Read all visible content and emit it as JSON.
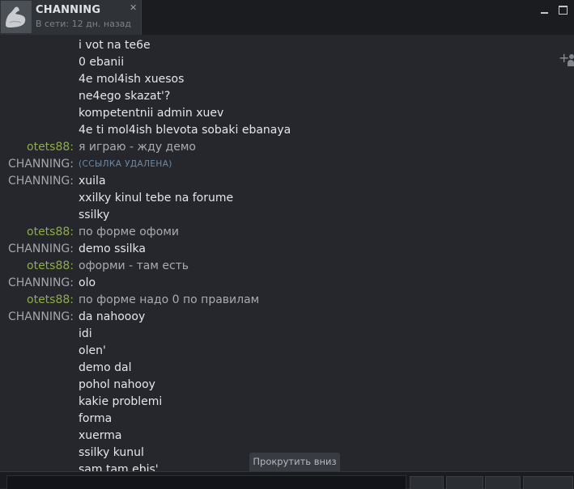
{
  "tab": {
    "name": "CHANNING",
    "status": "В сети: 12 дн. назад",
    "close": "✕"
  },
  "chat": {
    "messages": [
      {
        "sender": "",
        "text": "i vot na te6e",
        "kind": "me"
      },
      {
        "sender": "",
        "text": "0 ebanii",
        "kind": "me"
      },
      {
        "sender": "",
        "text": "4e mol4ish xuesos",
        "kind": "me"
      },
      {
        "sender": "",
        "text": "ne4ego skazat'?",
        "kind": "me"
      },
      {
        "sender": "",
        "text": "kompetentnii admin xuev",
        "kind": "me"
      },
      {
        "sender": "",
        "text": "4e ti mol4ish blevota sobaki ebanaya",
        "kind": "me"
      },
      {
        "sender": "otets88:",
        "text": "я играю - жду демо",
        "kind": "other"
      },
      {
        "sender": "CHANNING:",
        "text": "(ССЫЛКА УДАЛЕНА)",
        "kind": "removed"
      },
      {
        "sender": "CHANNING:",
        "text": "xuila",
        "kind": "me"
      },
      {
        "sender": "",
        "text": "xxilky kinul tebe na forume",
        "kind": "me"
      },
      {
        "sender": "",
        "text": "ssilky",
        "kind": "me"
      },
      {
        "sender": "otets88:",
        "text": "по форме офоми",
        "kind": "other"
      },
      {
        "sender": "CHANNING:",
        "text": "demo ssilka",
        "kind": "me"
      },
      {
        "sender": "otets88:",
        "text": "оформи - там есть",
        "kind": "other"
      },
      {
        "sender": "CHANNING:",
        "text": "olo",
        "kind": "me"
      },
      {
        "sender": "otets88:",
        "text": "по форме надо 0 по правилам",
        "kind": "other"
      },
      {
        "sender": "CHANNING:",
        "text": "da nahoooy",
        "kind": "me"
      },
      {
        "sender": "",
        "text": "idi",
        "kind": "me"
      },
      {
        "sender": "",
        "text": "olen'",
        "kind": "me"
      },
      {
        "sender": "",
        "text": "demo dal",
        "kind": "me"
      },
      {
        "sender": "",
        "text": "pohol nahooy",
        "kind": "me"
      },
      {
        "sender": "",
        "text": "kakie problemi",
        "kind": "me"
      },
      {
        "sender": "",
        "text": "forma",
        "kind": "me"
      },
      {
        "sender": "",
        "text": "xuerma",
        "kind": "me"
      },
      {
        "sender": "",
        "text": "ssilky kunul",
        "kind": "me"
      },
      {
        "sender": "",
        "text": "sam tam ebis'",
        "kind": "me"
      }
    ]
  },
  "scroll_button": "Прокрутить вниз",
  "icons": {
    "avatar": "flexed-arm-icon",
    "add_friend": "add-friend-icon"
  },
  "colors": {
    "other_sender": "#8fad47",
    "my_text": "#e4e6e8",
    "other_text": "#a8acb1",
    "removed_link": "#6e8aa6"
  }
}
